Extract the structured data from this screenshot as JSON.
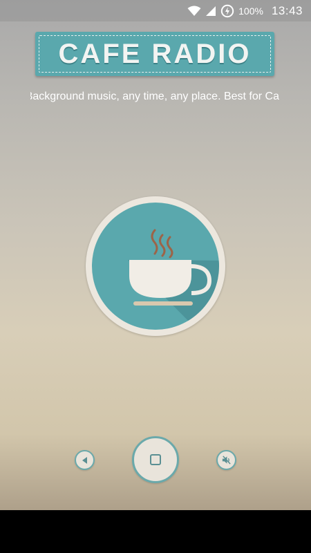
{
  "status_bar": {
    "battery": "100%",
    "time": "13:43",
    "icons": [
      "wifi-icon",
      "signal-icon",
      "battery-saver-icon"
    ]
  },
  "header": {
    "title": "CAFE RADIO"
  },
  "ticker": {
    "text": "Background music, any time, any place. Best for Ca"
  },
  "logo": {
    "icon": "coffee-cup-icon"
  },
  "controls": {
    "prev": "previous-icon",
    "stop": "stop-icon",
    "mute": "mute-icon"
  },
  "colors": {
    "accent": "#5aa8ad",
    "cream": "#ece7de",
    "steam": "#9c6448"
  }
}
